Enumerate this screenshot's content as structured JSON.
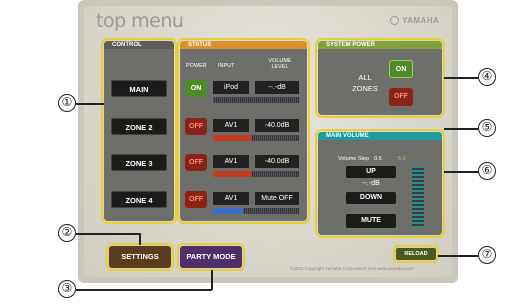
{
  "header": {
    "title": "top menu",
    "brand": "YAMAHA"
  },
  "control": {
    "label": "CONTROL",
    "zones": [
      "MAIN",
      "ZONE 2",
      "ZONE 3",
      "ZONE 4"
    ]
  },
  "status": {
    "label": "STATUS",
    "columns": [
      "POWER",
      "INPUT",
      "VOLUME LEVEL"
    ],
    "rows": [
      {
        "power": "ON",
        "input": "iPod",
        "volume": "--.-dB",
        "level": 0.0
      },
      {
        "power": "OFF",
        "input": "AV1",
        "volume": "-40.0dB",
        "level": 0.45
      },
      {
        "power": "OFF",
        "input": "AV1",
        "volume": "-40.0dB",
        "level": 0.45
      },
      {
        "power": "OFF",
        "input": "AV1",
        "volume": "Mute OFF",
        "level": 0.35
      }
    ]
  },
  "system_power": {
    "label": "SYSTEM POWER",
    "all_zones": "ALL ZONES",
    "on": "ON",
    "off": "OFF"
  },
  "main_volume": {
    "label": "MAIN VOLUME",
    "step_label": "Volume Step",
    "step_a": "0.5",
    "step_b": "5.0",
    "up": "UP",
    "readout": "--.-dB",
    "down": "DOWN",
    "mute": "MUTE"
  },
  "buttons": {
    "settings": "SETTINGS",
    "party_mode": "PARTY MODE",
    "reload": "RELOAD"
  },
  "footer": {
    "copyright": "©2010 Copyright Yamaha Corporation Visit www.yamaha.com"
  },
  "callouts": [
    "①",
    "②",
    "③",
    "④",
    "⑤",
    "⑥",
    "⑦"
  ],
  "colors": {
    "on_green": "#4e8a25",
    "off_red": "#8a2418",
    "highlight": "#e8cf33",
    "status_orange": "#d9922a",
    "sys_green": "#7fa33a",
    "vol_teal": "#1f9aa0"
  }
}
